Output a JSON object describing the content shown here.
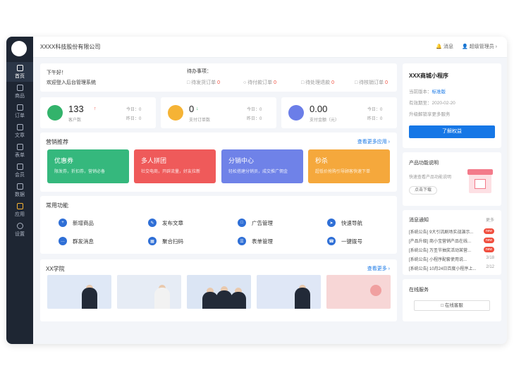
{
  "sidebar": {
    "items": [
      {
        "label": "首页",
        "icon": "home-icon"
      },
      {
        "label": "商品",
        "icon": "goods-icon"
      },
      {
        "label": "订单",
        "icon": "order-icon"
      },
      {
        "label": "文章",
        "icon": "article-icon"
      },
      {
        "label": "表单",
        "icon": "form-icon"
      },
      {
        "label": "会员",
        "icon": "member-icon"
      },
      {
        "label": "数据",
        "icon": "data-icon"
      },
      {
        "label": "应用",
        "icon": "apps-icon"
      },
      {
        "label": "设置",
        "icon": "settings-icon"
      }
    ]
  },
  "header": {
    "company": "XXXX科技股份有限公司",
    "messages": "消息",
    "admin": "超级管理员"
  },
  "welcome": {
    "greeting": "下午好！",
    "subtitle": "欢迎登入后台管理系统"
  },
  "todo": {
    "title": "待办事项：",
    "items": [
      {
        "label": "待发货订单",
        "count": "0"
      },
      {
        "label": "待付款订单",
        "count": "0"
      },
      {
        "label": "待处理退款",
        "count": "0"
      },
      {
        "label": "待核销订单",
        "count": "0"
      }
    ]
  },
  "stats": [
    {
      "value": "133",
      "label": "客户数",
      "today_label": "今日：0",
      "yesterday_label": "昨日：0",
      "color": "#33b36b"
    },
    {
      "value": "0",
      "label": "支付订单数",
      "today_label": "今日：0",
      "yesterday_label": "昨日：0",
      "color": "#f5b335"
    },
    {
      "value": "0.00",
      "label": "支付金额（元）",
      "today_label": "今日：0",
      "yesterday_label": "昨日：0",
      "color": "#6b7ee8"
    }
  ],
  "marketing": {
    "title": "营销推荐",
    "more": "查看更多应用",
    "cards": [
      {
        "title": "优惠券",
        "desc": "限发券，折扣券，营销必备",
        "color": "#35b87d"
      },
      {
        "title": "多人拼团",
        "desc": "社交电商，开辟流量，好友拉新",
        "color": "#ef5a5a"
      },
      {
        "title": "分销中心",
        "desc": "轻松搭建分销员，成交推广佣金",
        "color": "#6f82e8"
      },
      {
        "title": "秒杀",
        "desc": "超低价抢购引导顾客快速下单",
        "color": "#f5a83c"
      }
    ]
  },
  "functions": {
    "title": "常用功能",
    "items": [
      {
        "label": "新增商品",
        "icon": "add-goods-icon"
      },
      {
        "label": "发布文章",
        "icon": "publish-article-icon"
      },
      {
        "label": "广告管理",
        "icon": "ad-icon"
      },
      {
        "label": "快速导航",
        "icon": "compass-icon"
      },
      {
        "label": "群发消息",
        "icon": "chat-icon"
      },
      {
        "label": "聚合扫码",
        "icon": "scan-icon"
      },
      {
        "label": "表单管理",
        "icon": "form-manage-icon"
      },
      {
        "label": "一键拨号",
        "icon": "phone-icon"
      }
    ]
  },
  "academy": {
    "title": "XX学院",
    "more": "查看更多",
    "courses": [
      {
        "color": "#dfe8f6"
      },
      {
        "color": "#e6ecf5"
      },
      {
        "color": "#dbe5f4"
      },
      {
        "color": "#dfe7f6"
      },
      {
        "color": "#f7d6d6"
      }
    ]
  },
  "miniapp": {
    "title": "XXX商城小程序",
    "version_label": "当前版本：",
    "version": "标准版",
    "expiry_label": "有效期至：",
    "expiry": "2020-02-20",
    "upgrade": "升级解锁享更多服务",
    "button": "了解权益"
  },
  "feature_intro": {
    "title": "产品功能说明",
    "desc": "快速查看产品功能说明",
    "button": "点击下载"
  },
  "notices": {
    "title": "消息通知",
    "more": "更多",
    "items": [
      {
        "text": "[系统公告] 9大引流剧场实战演示...",
        "badge": "new"
      },
      {
        "text": "[产品升级] 商小宝营销产品在线...",
        "badge": "new"
      },
      {
        "text": "[系统公告] 万圣节抽奖活动某营...",
        "badge": "new"
      },
      {
        "text": "[系统公告] 小程序配套使用说...",
        "date": "3/18"
      },
      {
        "text": "[系统公告] 10月24日百度小程序上...",
        "date": "2/12"
      }
    ]
  },
  "online": {
    "title": "在线服务",
    "button": "在线客服"
  }
}
